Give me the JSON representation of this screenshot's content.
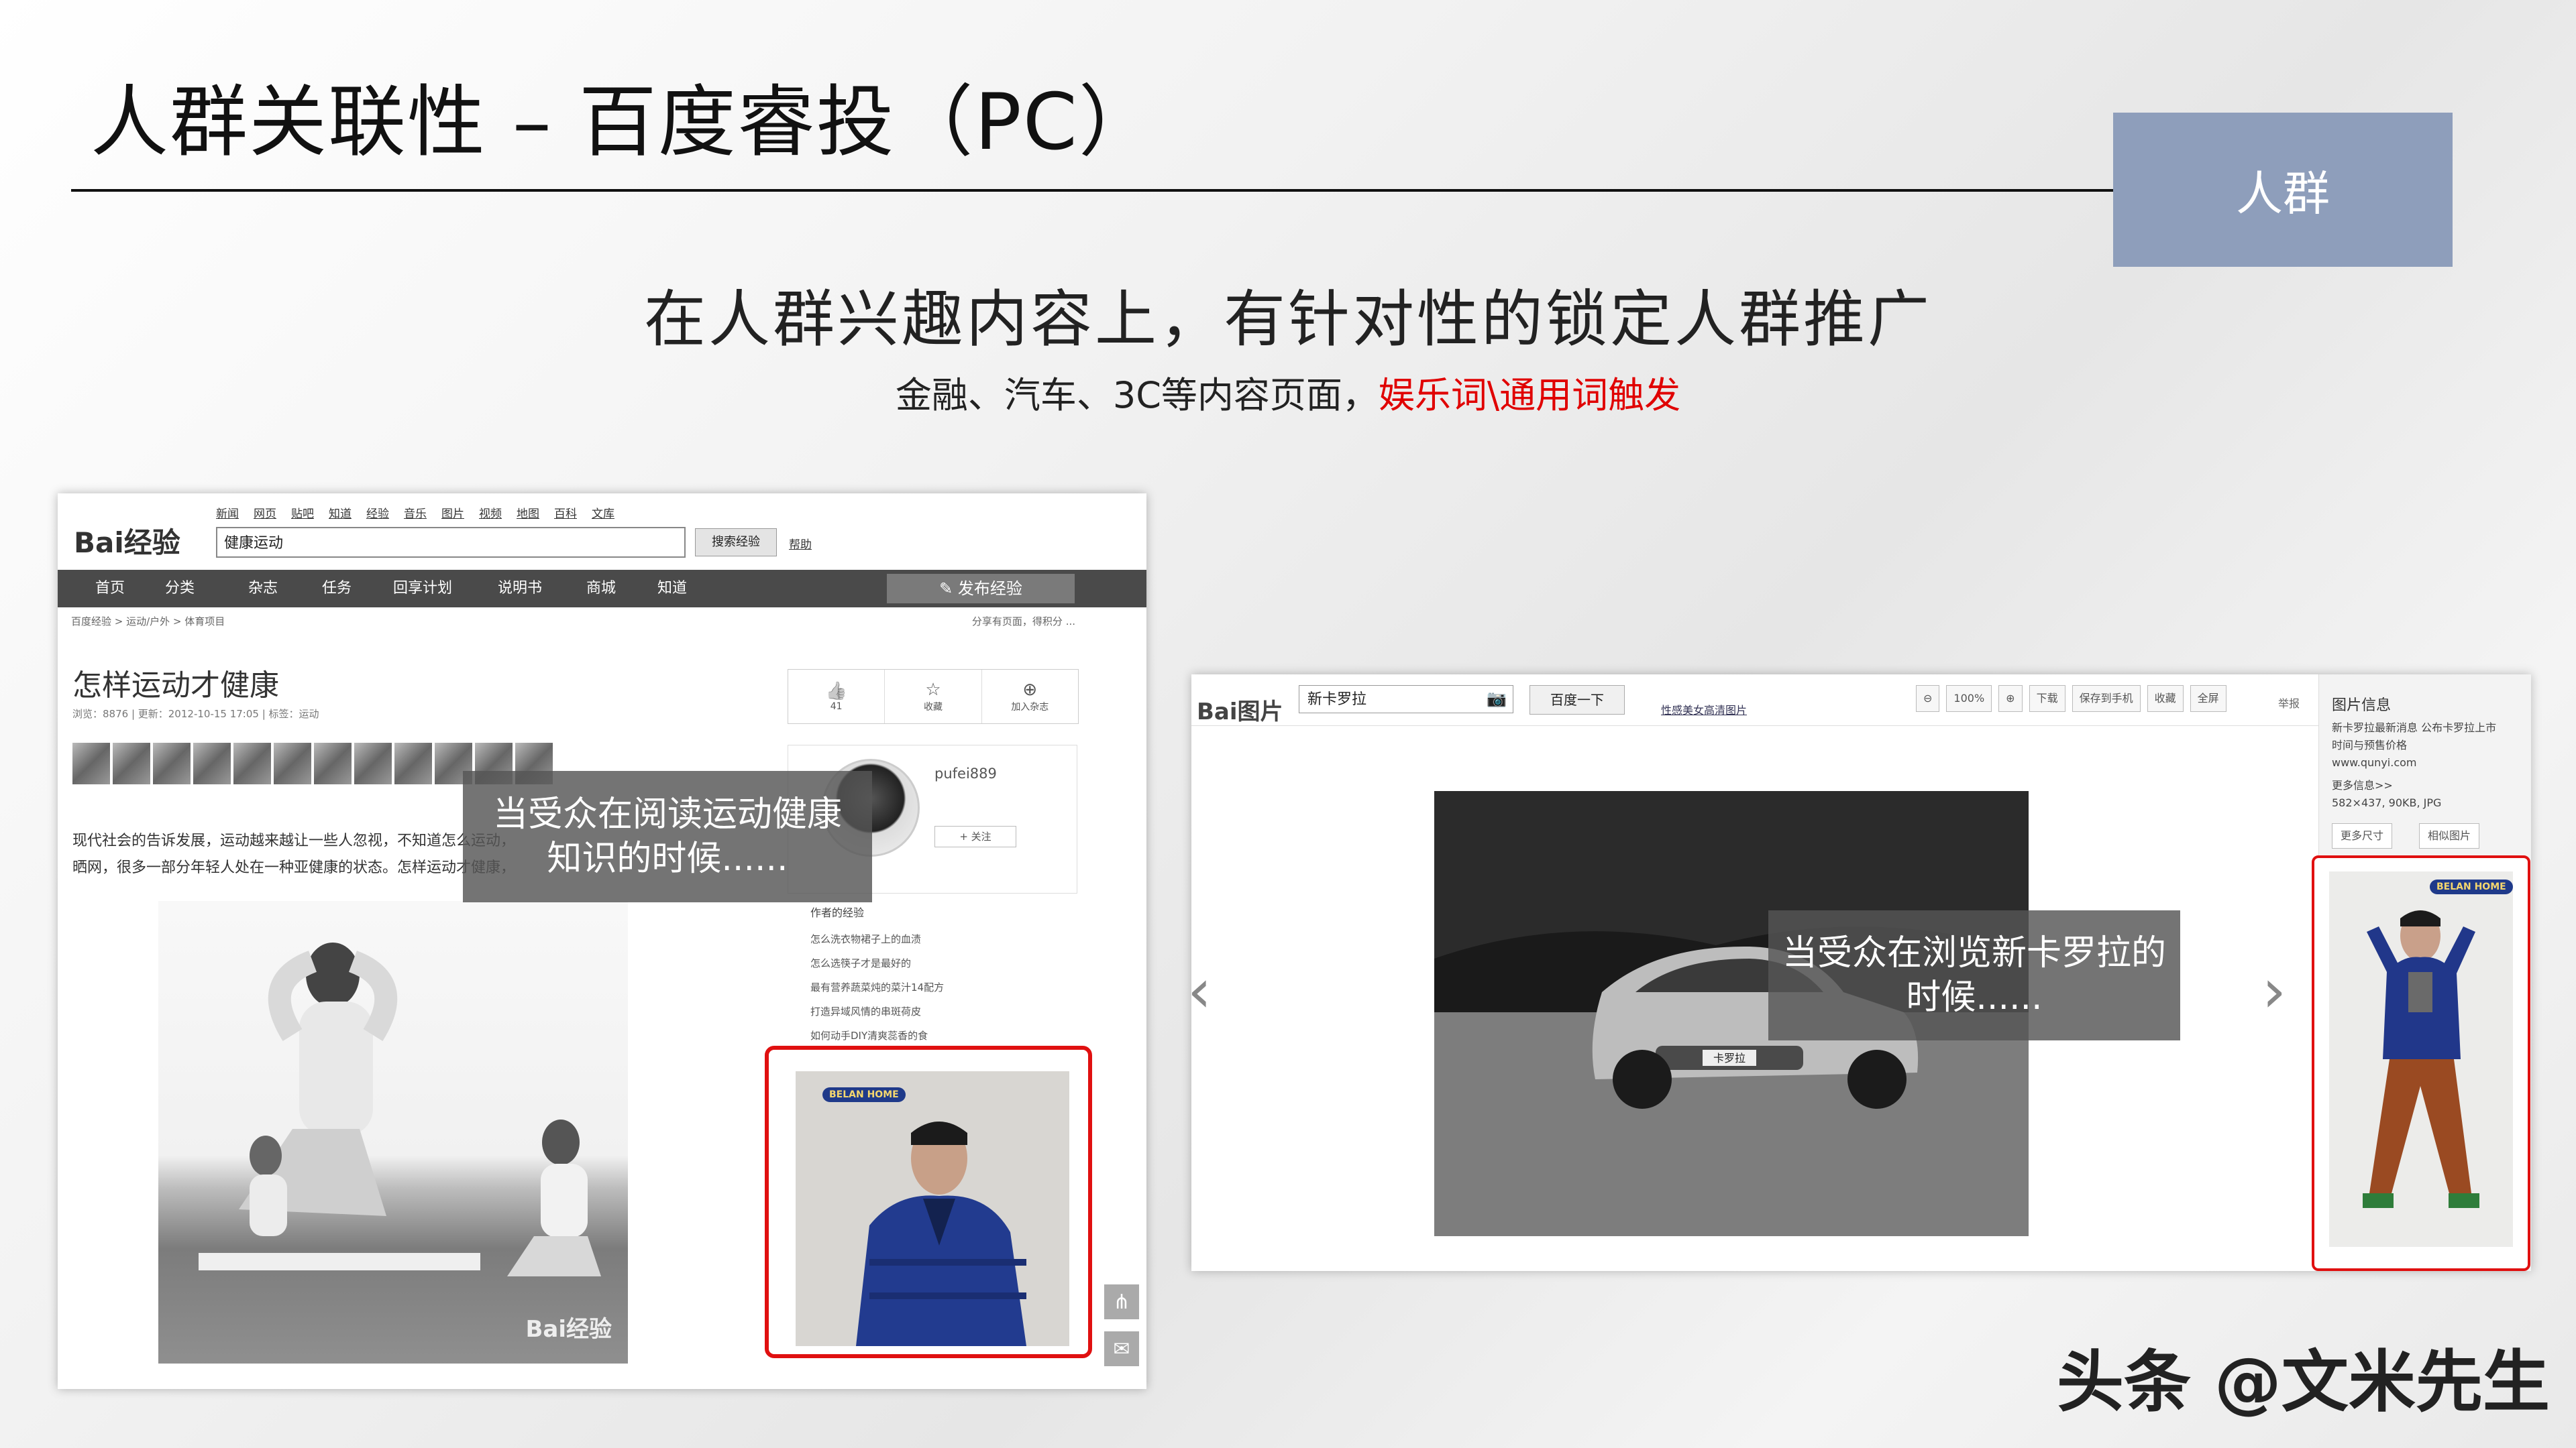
{
  "slide": {
    "title": "人群关联性 – 百度睿投（PC）",
    "tag": "人群",
    "headline": "在人群兴趣内容上，有针对性的锁定人群推广",
    "subline_prefix": "金融、汽车、3C等内容页面，",
    "subline_accent": "娱乐词\\通用词触发",
    "watermark": "头条 @文米先生"
  },
  "colors": {
    "accent_red": "#e00000",
    "tag_bg": "#8e9ebb",
    "ad_frame": "#e01010"
  },
  "left_page": {
    "logo": "Bai经验",
    "top_links": [
      "新闻",
      "网页",
      "贴吧",
      "知道",
      "经验",
      "音乐",
      "图片",
      "视频",
      "地图",
      "百科",
      "文库"
    ],
    "search_value": "健康运动",
    "search_button": "搜索经验",
    "help": "帮助",
    "nav": [
      "首页",
      "分类",
      "杂志",
      "任务",
      "回享计划",
      "说明书",
      "商城",
      "知道"
    ],
    "publish_button": "发布经验",
    "breadcrumb": "百度经验 > 运动/户外 > 体育项目",
    "breadcrumb_right": "分享有页面，得积分 ...",
    "article_title": "怎样运动才健康",
    "meta": "浏览：8876  |  更新：2012-10-15 17:05  |  标签：运动",
    "body_lines": [
      "现代社会的告诉发展，运动越来越让一些人忽视，不知道怎么运动，",
      "晒网，很多一部分年轻人处在一种亚健康的状态。怎样运动才健康，"
    ],
    "photo_watermark": "Bai经验",
    "side_actions": [
      {
        "icon": "thumbs-up",
        "label": "41"
      },
      {
        "icon": "star",
        "label": "收藏"
      },
      {
        "icon": "plus",
        "label": "加入杂志"
      }
    ],
    "author": {
      "name": "pufei889",
      "follow": "+ 关注"
    },
    "links_title": "作者的经验",
    "links": [
      "怎么洗衣物裙子上的血渍",
      "怎么选筷子才是最好的",
      "最有营养蔬菜炖的菜汁14配方",
      "打造异域风情的串斑荷皮",
      "如何动手DIY清爽蕊香的食"
    ],
    "overlay_text": "当受众在阅读运动健康知识的时候......",
    "ad_brand": "BELAN HOME"
  },
  "right_page": {
    "logo": "Bai图片",
    "search_value": "新卡罗拉",
    "search_button": "百度一下",
    "extra_link": "性感美女高清图片",
    "tools": [
      "100%",
      "下载",
      "保存到手机",
      "收藏",
      "全屏"
    ],
    "report": "举报",
    "panel_title": "图片信息",
    "panel_lines": [
      "新卡罗拉最新消息 公布卡罗拉上市",
      "时间与预售价格",
      "www.qunyi.com",
      "更多信息>>",
      "582×437, 90KB, JPG"
    ],
    "panel_buttons": [
      "更多尺寸",
      "相似图片"
    ],
    "plate": "卡罗拉",
    "overlay_text": "当受众在浏览新卡罗拉的时候......",
    "ad_brand": "BELAN HOME"
  }
}
